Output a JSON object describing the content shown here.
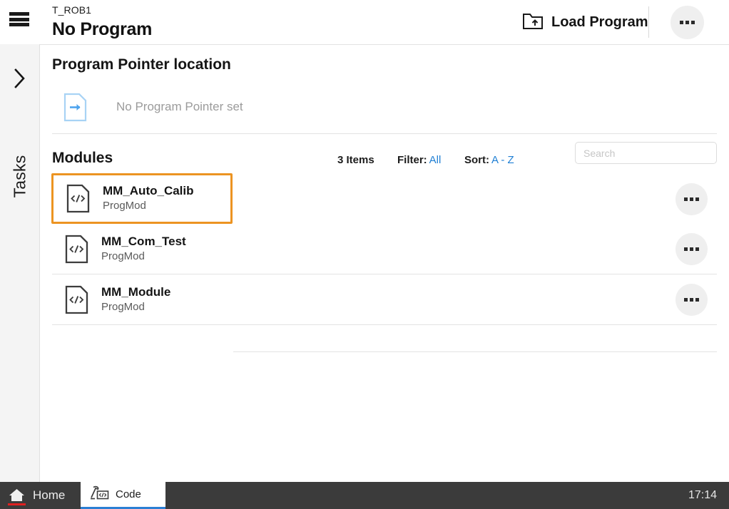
{
  "header": {
    "menu_icon": "hamburger-icon",
    "task_name": "T_ROB1",
    "program_title": "No Program",
    "load_program_label": "Load Program",
    "load_program_icon": "folder-up-arrow-icon",
    "more_icon": "ellipsis-icon"
  },
  "sidebar": {
    "expand_icon": "chevron-right-icon",
    "tasks_label": "Tasks"
  },
  "program_pointer": {
    "section_title": "Program Pointer location",
    "status_text": "No Program Pointer set",
    "status_icon": "document-arrow-icon"
  },
  "modules": {
    "section_title": "Modules",
    "item_count": "3 Items",
    "filter_label": "Filter:",
    "filter_value": "All",
    "sort_label": "Sort:",
    "sort_value": "A - Z",
    "search_placeholder": "Search",
    "search_value": "",
    "row_icon": "code-document-icon",
    "row_more_icon": "ellipsis-icon",
    "items": [
      {
        "name": "MM_Auto_Calib",
        "type": "ProgMod",
        "selected": true
      },
      {
        "name": "MM_Com_Test",
        "type": "ProgMod",
        "selected": false
      },
      {
        "name": "MM_Module",
        "type": "ProgMod",
        "selected": false
      }
    ]
  },
  "taskbar": {
    "home_label": "Home",
    "home_icon": "home-icon",
    "tab_label": "Code",
    "tab_icon": "robot-code-icon",
    "clock": "17:14"
  },
  "colors": {
    "accent_orange": "#ec9422",
    "link_blue": "#1f7fd4",
    "tab_blue": "#2b7fd4",
    "home_red": "#e02020",
    "taskbar_bg": "#3b3b3b",
    "sidebar_bg": "#f4f4f4",
    "pill_gray": "#efefef"
  }
}
